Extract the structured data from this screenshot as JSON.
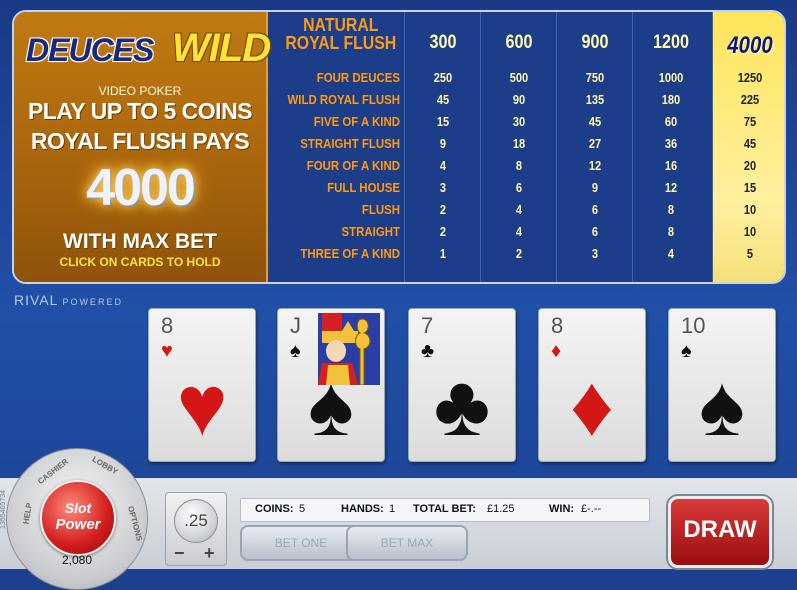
{
  "logo": {
    "part1": "DEUCES",
    "part2": "WILD"
  },
  "promo": {
    "subtitle": "VIDEO POKER",
    "line1": "PLAY UP TO 5 COINS",
    "line2": "ROYAL FLUSH PAYS",
    "amount": "4000",
    "line3": "WITH MAX BET",
    "line4": "CLICK ON CARDS TO HOLD"
  },
  "paytable": {
    "highlight_column": 5,
    "rows": [
      {
        "hand": "NATURAL ROYAL FLUSH",
        "pays": [
          "300",
          "600",
          "900",
          "1200",
          "4000"
        ]
      },
      {
        "hand": "FOUR DEUCES",
        "pays": [
          "250",
          "500",
          "750",
          "1000",
          "1250"
        ]
      },
      {
        "hand": "WILD ROYAL FLUSH",
        "pays": [
          "45",
          "90",
          "135",
          "180",
          "225"
        ]
      },
      {
        "hand": "FIVE OF A KIND",
        "pays": [
          "15",
          "30",
          "45",
          "60",
          "75"
        ]
      },
      {
        "hand": "STRAIGHT FLUSH",
        "pays": [
          "9",
          "18",
          "27",
          "36",
          "45"
        ]
      },
      {
        "hand": "FOUR OF A KIND",
        "pays": [
          "4",
          "8",
          "12",
          "16",
          "20"
        ]
      },
      {
        "hand": "FULL HOUSE",
        "pays": [
          "3",
          "6",
          "9",
          "12",
          "15"
        ]
      },
      {
        "hand": "FLUSH",
        "pays": [
          "2",
          "4",
          "6",
          "8",
          "10"
        ]
      },
      {
        "hand": "STRAIGHT",
        "pays": [
          "2",
          "4",
          "6",
          "8",
          "10"
        ]
      },
      {
        "hand": "THREE OF A KIND",
        "pays": [
          "1",
          "2",
          "3",
          "4",
          "5"
        ]
      }
    ]
  },
  "branding": {
    "rival": "RIVAL",
    "powered": "POWERED"
  },
  "cards": [
    {
      "rank": "8",
      "suit": "♥",
      "suit_name": "hearts",
      "color": "red"
    },
    {
      "rank": "J",
      "suit": "♠",
      "suit_name": "spades",
      "color": "black"
    },
    {
      "rank": "7",
      "suit": "♣",
      "suit_name": "clubs",
      "color": "black"
    },
    {
      "rank": "8",
      "suit": "♦",
      "suit_name": "diamonds",
      "color": "red"
    },
    {
      "rank": "10",
      "suit": "♠",
      "suit_name": "spades",
      "color": "black"
    }
  ],
  "dial": {
    "cashier": "CASHIER",
    "lobby": "LOBBY",
    "help": "HELP",
    "options": "OPTIONS",
    "slot": "Slot",
    "power": "Power",
    "balance": "2,080",
    "side_id": "1355465734"
  },
  "coin": {
    "value": ".25",
    "minus": "−",
    "plus": "+"
  },
  "status": {
    "coins_label": "COINS:",
    "coins_value": "5",
    "hands_label": "HANDS:",
    "hands_value": "1",
    "total_label": "TOTAL BET:",
    "total_value": "£1.25",
    "win_label": "WIN:",
    "win_value": "£-.--"
  },
  "buttons": {
    "bet_one": "BET ONE",
    "bet_max": "BET MAX",
    "draw": "DRAW"
  }
}
